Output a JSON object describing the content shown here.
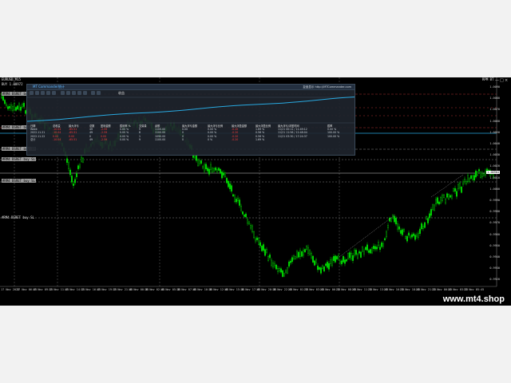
{
  "window": {
    "symbol_label": "EURUSD,M15",
    "sub_label": "BUY 1.00972",
    "right_label": "RPM BT",
    "controls": [
      "—",
      "□",
      "×"
    ]
  },
  "colors": {
    "background": "#000000",
    "bull_candle": "#00e000",
    "equity_line": "#29a9e0",
    "loss_text": "#ff3b3b",
    "grid_dash": "#8a8a8a",
    "level_line_red": "#c83232"
  },
  "left_tags": [
    {
      "label": "#RM4 BSRET buy"
    },
    {
      "label": "#RM4 BSRET buy"
    },
    {
      "label": "#RM4 BSRET buy TP"
    },
    {
      "label": "#RM4 BSRET buy SL"
    },
    {
      "label": "#RM4 BSRET buy SL"
    },
    {
      "label": "#RM4 BSRET buy SL"
    }
  ],
  "price_axis": {
    "ticks": [
      "1.0090",
      "1.0080",
      "1.0070",
      "1.0060",
      "1.0050",
      "1.0040",
      "1.0030",
      "1.0020",
      "1.0010",
      "1.0000",
      "0.9990",
      "0.9980",
      "0.9970",
      "0.9960",
      "0.9950",
      "0.9940",
      "0.9930",
      "0.9920"
    ],
    "current_price": "1.00984"
  },
  "time_axis": {
    "ticks": [
      "17 Nov 2022",
      "17 Nov 06:45",
      "17 Nov 09:15",
      "17 Nov 11:45",
      "17 Nov 14:15",
      "17 Nov 16:45",
      "17 Nov 19:15",
      "17 Nov 21:45",
      "18 Nov 00:15",
      "18 Nov 02:45",
      "18 Nov 05:15",
      "18 Nov 07:45",
      "18 Nov 10:15",
      "18 Nov 12:45",
      "18 Nov 15:15",
      "18 Nov 17:45",
      "18 Nov 20:15",
      "18 Nov 22:45",
      "21 Nov 01:15",
      "21 Nov 03:45",
      "21 Nov 06:15",
      "21 Nov 08:45",
      "21 Nov 11:15",
      "21 Nov 13:45",
      "21 Nov 16:15",
      "21 Nov 18:45",
      "21 Nov 21:15",
      "22 Nov 00:45",
      "22 Nov 03:15",
      "22 Nov 05:45"
    ]
  },
  "panel": {
    "title": "MT Commander统计",
    "site": "复盘显示 http://MTCommander.com",
    "chart_title": "收益",
    "table": {
      "headers": [
        "日期",
        "总收益",
        "最大浮亏",
        "总数",
        "盈利金额",
        "胜利率 %",
        "交易量",
        "余额",
        "最大浮亏金额",
        "最大浮亏比例",
        "最大浮盈金额",
        "最大浮盈比例",
        "最大浮亏/浮盈时间",
        "胜率"
      ],
      "rows": [
        [
          "Week",
          "-10.04",
          "-65.51",
          "49",
          "-2.59",
          "0.00 %",
          "9",
          "1100.00",
          "0.00",
          "0.00 %",
          "-0.20",
          "1.69 %",
          "11/21 00:11 / 11:49:12",
          "0.00 %"
        ],
        [
          "2022.11.21",
          "-10.04",
          "-65.51",
          "49",
          "-2.59",
          "0.00 %",
          "8",
          "1100.00",
          "0",
          "0.00 %",
          "-0.20",
          "0.56 %",
          "11/21 11:56 / 12:48:04",
          "100.00 %"
        ],
        [
          "2022.11.22",
          "0.00",
          "0.00",
          "0",
          "0.00",
          "0.00 %",
          "1",
          "1090.00",
          "0",
          "0.00 %",
          "-0.20",
          "0.56 %",
          "11/21 03:30 / 17:24:37",
          "100.00 %"
        ],
        [
          "总计",
          "-10.04",
          "-65.51",
          "49",
          "-2.59",
          "0.00 %",
          "9",
          "1100.00",
          "0",
          "0 %",
          "-0.20",
          "1.69 %",
          "",
          ""
        ]
      ]
    }
  },
  "watermark": "www.mt4.shop"
}
